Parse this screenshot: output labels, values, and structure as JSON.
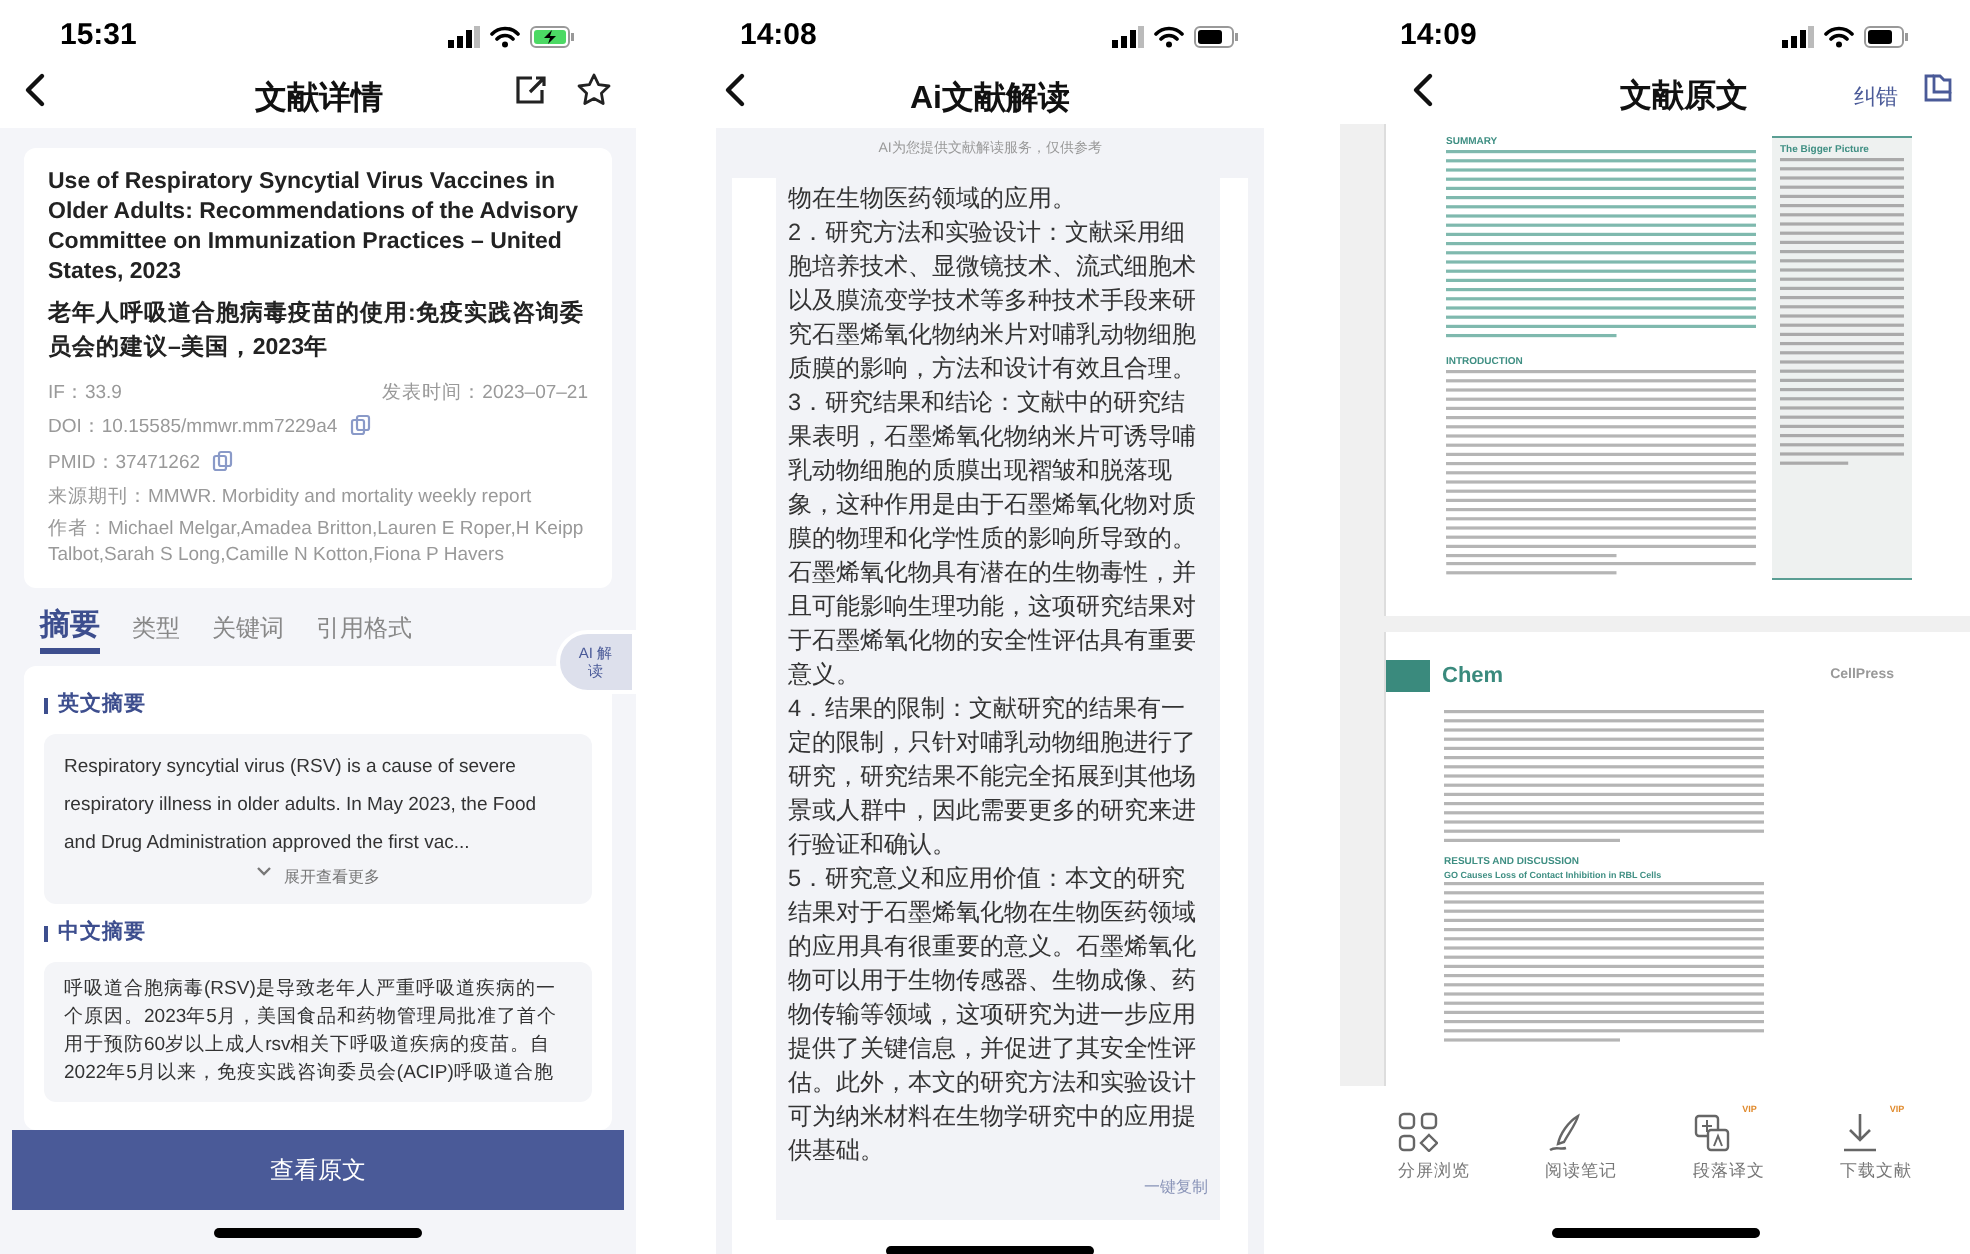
{
  "detail_screen": {
    "status": {
      "time": "15:31",
      "battery_charging": true
    },
    "title": "文献详情",
    "paper": {
      "title_en": "Use of Respiratory Syncytial Virus Vaccines in Older Adults: Recommendations of the Advisory Committee on Immunization Practices – United States, 2023",
      "title_zh": "老年人呼吸道合胞病毒疫苗的使用:免疫实践咨询委员会的建议–美国，2023年",
      "impact": "IF：33.9",
      "published": "发表时间：2023–07–21",
      "doi": "DOI：10.15585/mmwr.mm7229a4",
      "pmid": "PMID：37471262",
      "journal": "来源期刊：MMWR. Morbidity and mortality weekly report",
      "authors": "作者：Michael Melgar,Amadea Britton,Lauren E Roper,H Keipp Talbot,Sarah S Long,Camille N Kotton,Fiona P Havers"
    },
    "tabs": [
      {
        "label": "摘要",
        "selected": true
      },
      {
        "label": "类型",
        "selected": false
      },
      {
        "label": "关键词",
        "selected": false
      },
      {
        "label": "引用格式",
        "selected": false
      }
    ],
    "ai_button": "AI 解读",
    "sections": [
      {
        "heading": "英文摘要",
        "text": "Respiratory syncytial virus (RSV) is a cause of severe respiratory illness in older adults. In May 2023, the Food and Drug Administration approved the first vac...",
        "expand": "展开查看更多"
      },
      {
        "heading": "中文摘要",
        "text": "呼吸道合胞病毒(RSV)是导致老年人严重呼吸道疾病的一个原因。2023年5月，美国食品和药物管理局批准了首个用于预防60岁以上成人rsv相关下呼吸道疾病的疫苗。自2022年5月以来，免疫实践咨询委员会(ACIP)呼吸道合胞"
      }
    ],
    "bottom_button": "查看原文"
  },
  "ai_screen": {
    "status": {
      "time": "14:08",
      "battery_charging": false
    },
    "title": "Ai文献解读",
    "notice": "AI为您提供文献解读服务，仅供参考",
    "paragraphs": [
      "物在生物医药领域的应用。",
      "2．研究方法和实验设计：文献采用细胞培养技术、显微镜技术、流式细胞术以及膜流变学技术等多种技术手段来研究石墨烯氧化物纳米片对哺乳动物细胞质膜的影响，方法和设计有效且合理。",
      "3．研究结果和结论：文献中的研究结果表明，石墨烯氧化物纳米片可诱导哺乳动物细胞的质膜出现褶皱和脱落现象，这种作用是由于石墨烯氧化物对质膜的物理和化学性质的影响所导致的。石墨烯氧化物具有潜在的生物毒性，并且可能影响生理功能，这项研究结果对于石墨烯氧化物的安全性评估具有重要意义。",
      "4．结果的限制：文献研究的结果有一定的限制，只针对哺乳动物细胞进行了研究，研究结果不能完全拓展到其他场景或人群中，因此需要更多的研究来进行验证和确认。",
      "5．研究意义和应用价值：本文的研究结果对于石墨烯氧化物在生物医药领域的应用具有很重要的意义。石墨烯氧化物可以用于生物传感器、生物成像、药物传输等领域，这项研究为进一步应用提供了关键信息，并促进了其安全性评估。此外，本文的研究方法和实验设计可为纳米材料在生物学研究中的应用提供基础。"
    ],
    "copy_button": "一键复制"
  },
  "original_screen": {
    "status": {
      "time": "14:09",
      "battery_charging": false
    },
    "title": "文献原文",
    "report_link": "纠错",
    "page_1": {
      "summary_heading": "SUMMARY",
      "intro_heading": "INTRODUCTION",
      "sidebar_heading": "The Bigger Picture"
    },
    "page_2": {
      "journal": "Chem",
      "publisher": "CellPress",
      "results_heading": "RESULTS AND DISCUSSION",
      "subheading": "GO Causes Loss of Contact Inhibition in RBL Cells"
    },
    "toolbar": [
      {
        "kind": "split",
        "label": "分屏浏览"
      },
      {
        "kind": "notes",
        "label": "阅读笔记"
      },
      {
        "kind": "translate",
        "label": "段落译文",
        "badge": "VIP"
      },
      {
        "kind": "download",
        "label": "下载文献",
        "badge": "VIP"
      }
    ]
  }
}
